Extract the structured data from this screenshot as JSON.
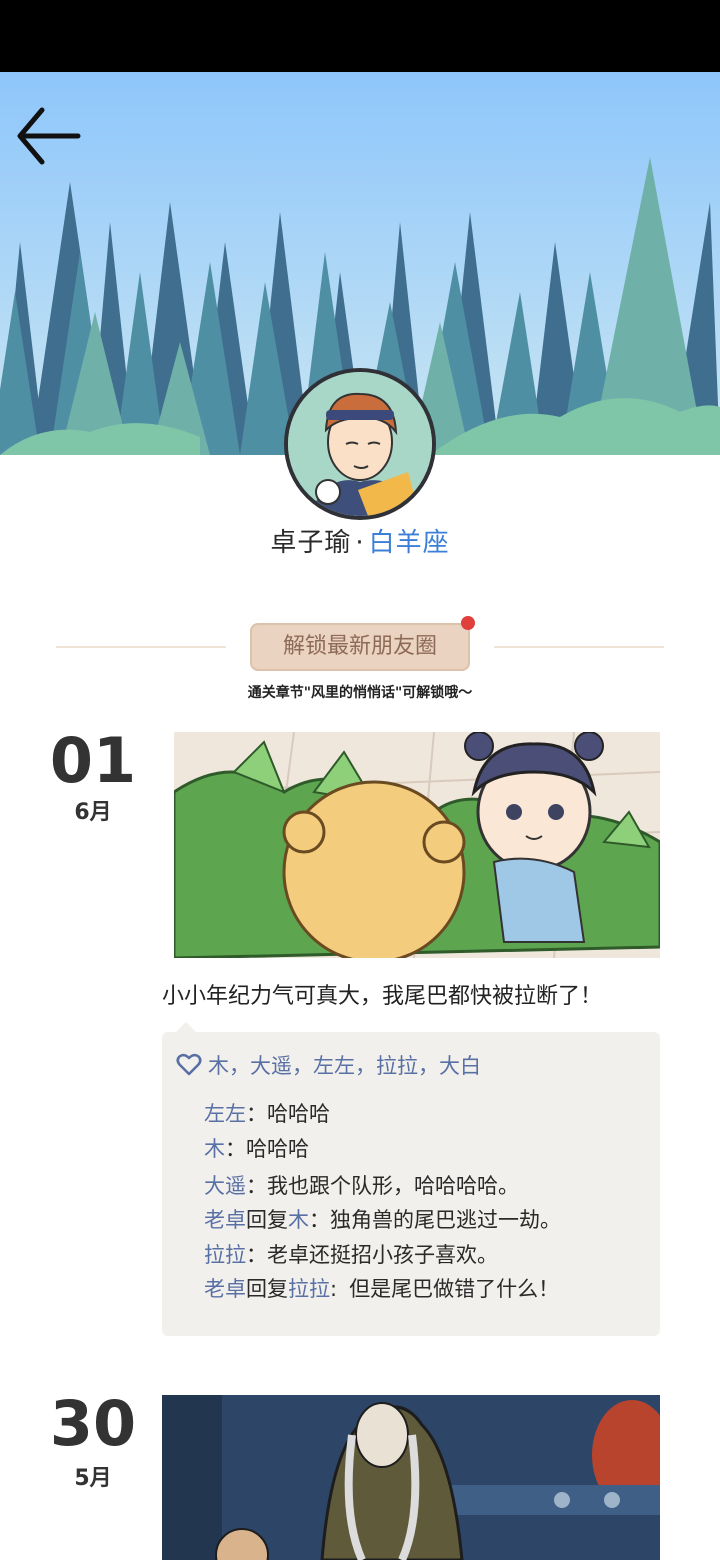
{
  "profile": {
    "name": "卓子瑜",
    "separator": "·",
    "zodiac": "白羊座"
  },
  "unlock": {
    "button_label": "解锁最新朋友圈",
    "hint": "通关章节\"风里的悄悄话\"可解锁哦～"
  },
  "posts": [
    {
      "day": "01",
      "month": "6月",
      "text": "小小年纪力气可真大，我尾巴都快被拉断了！",
      "likes": "木，大遥，左左，拉拉，大白",
      "comments": [
        {
          "user": "左左",
          "sep": "：",
          "text": "哈哈哈"
        },
        {
          "user": "木",
          "sep": "：",
          "text": "哈哈哈"
        },
        {
          "user": "大遥",
          "sep": "：",
          "text": "我也跟个队形，哈哈哈哈。"
        },
        {
          "user": "老卓",
          "reply_word": "回复",
          "reply_to": "木",
          "sep": "：",
          "text": "独角兽的尾巴逃过一劫。"
        },
        {
          "user": "拉拉",
          "sep": "：",
          "text": "老卓还挺招小孩子喜欢。"
        },
        {
          "user": "老卓",
          "reply_word": "回复",
          "reply_to": "拉拉",
          "sep": ":",
          "text": "但是尾巴做错了什么！"
        }
      ]
    },
    {
      "day": "30",
      "month": "5月"
    }
  ],
  "colors": {
    "username": "#5970a5",
    "zodiac": "#3c7fd6",
    "unlock_bg": "#ead3c0",
    "notice_dot": "#e0403b"
  },
  "icons": [
    "back-arrow-icon",
    "heart-outline-icon",
    "notification-dot"
  ]
}
